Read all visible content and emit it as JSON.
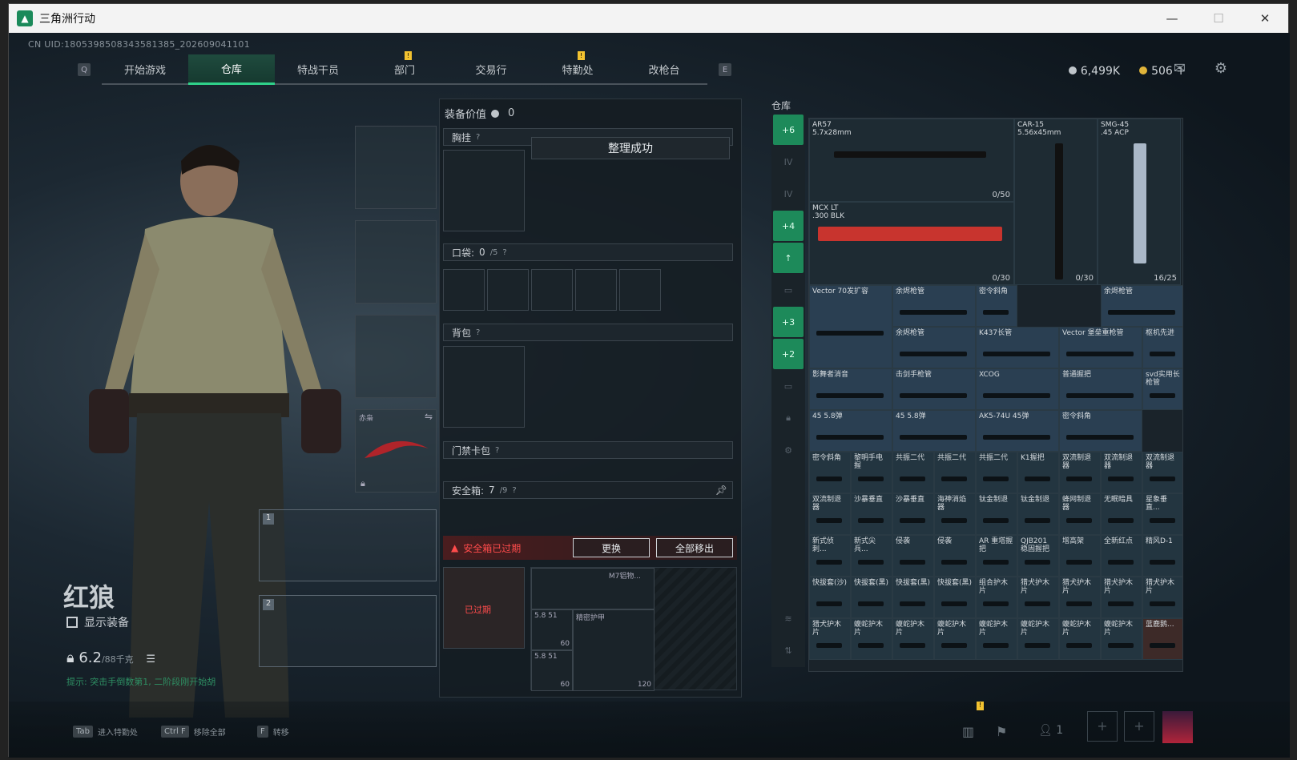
{
  "window": {
    "app_title": "三角洲行动",
    "controls": [
      "—",
      "☐",
      "✕"
    ]
  },
  "uid_text": "CN UID:1805398508343581385_202609041101",
  "tabs": {
    "left_key": "Q",
    "right_key": "E",
    "items": [
      {
        "label": "开始游戏",
        "active": false,
        "badge": ""
      },
      {
        "label": "仓库",
        "active": true,
        "badge": ""
      },
      {
        "label": "特战干员",
        "active": false,
        "badge": ""
      },
      {
        "label": "部门",
        "active": false,
        "badge": "!"
      },
      {
        "label": "交易行",
        "active": false,
        "badge": ""
      },
      {
        "label": "特勤处",
        "active": false,
        "badge": "!"
      },
      {
        "label": "改枪台",
        "active": false,
        "badge": ""
      }
    ]
  },
  "currency": {
    "silver": "6,499K",
    "gold": "506",
    "gold_add": "+"
  },
  "character": {
    "name": "红狼",
    "show_equipment_label": "显示装备",
    "weight_value": "6.2",
    "weight_max": "/88千克",
    "hint": "提示: 突击手倒数第1, 二阶段刚开始胡",
    "melee_label": "赤枭",
    "slot_numbers": [
      "1",
      "2"
    ]
  },
  "equipment": {
    "value_label": "装备价值",
    "value_amount": "0",
    "chest_label": "胸挂",
    "toast": "整理成功",
    "pocket_label": "口袋:",
    "pocket_count": "0",
    "pocket_max": "/5",
    "backpack_label": "背包",
    "keycard_label": "门禁卡包",
    "safe_label": "安全箱:",
    "safe_count": "7",
    "safe_max": "/9",
    "expired_text": "安全箱已过期",
    "replace_btn": "更换",
    "remove_all_btn": "全部移出",
    "safe_expired_tag": "已过期",
    "safe_items": [
      {
        "label": "M7铝物...",
        "count": ""
      },
      {
        "label": "5.8 51",
        "count": "60"
      },
      {
        "label": "5.8 51",
        "count": "60"
      },
      {
        "label": "精密护甲",
        "count": "120"
      }
    ],
    "help_mark": "?"
  },
  "storage": {
    "title": "仓库",
    "side_items": [
      "+6",
      "IV",
      "IV",
      "+4",
      "↑",
      "",
      "+3",
      "+2",
      "",
      "",
      "",
      ""
    ],
    "weapons": [
      {
        "name": "AR57",
        "ammo": "5.7x28mm",
        "count": "0/50"
      },
      {
        "name": "CAR-15",
        "ammo": "5.56x45mm",
        "count": "0/30"
      },
      {
        "name": "SMG-45",
        "ammo": ".45 ACP",
        "count": "16/25"
      },
      {
        "name": "MCX LT",
        "ammo": ".300 BLK",
        "count": "0/30"
      }
    ],
    "parts": [
      "Vector 70发扩容",
      "余烬枪管",
      "密令斜角",
      "余烬枪管",
      "余烬枪管",
      "K437长管",
      "Vector 堡垒重枪管",
      "枢机先进",
      "影舞者消音",
      "击剑手枪管",
      "XCOG",
      "普通握把",
      "svd实用长枪管",
      "45 5.8弹",
      "45 5.8弹",
      "AK5-74U 45弹",
      "密令斜角",
      "密令斜角",
      "黎明手电握",
      "共振二代",
      "共振二代",
      "共振二代",
      "K1握把",
      "双流制退器",
      "双流制退器",
      "双流制退器",
      "双流制退器",
      "沙暴垂直",
      "沙暴垂直",
      "海神消焰器",
      "钛金制退",
      "钛金制退",
      "蜂网制退器",
      "无眠暗具",
      "星象垂直...",
      "新式侦刺...",
      "新式尖兵...",
      "侵袭",
      "侵袭",
      "AR 重塔握把",
      "QJB201 稳固握把",
      "增高架",
      "全新红点",
      "精风D-1",
      "快拔套(沙)",
      "快拔套(黑)",
      "快拔套(黑)",
      "快拔套(黑)",
      "组合护木片",
      "猎犬护木片",
      "猎犬护木片",
      "猎犬护木片",
      "猎犬护木片",
      "猎犬护木片",
      "蝮蛇护木片",
      "蝮蛇护木片",
      "蝮蛇护木片",
      "蝮蛇护木片",
      "蝮蛇护木片",
      "蝮蛇护木片",
      "蝮蛇护木片",
      "蓝鹿鹅..."
    ]
  },
  "bottom": {
    "keys": [
      {
        "key": "Tab",
        "label": "进入特勤处"
      },
      {
        "key": "Ctrl F",
        "label": "移除全部"
      },
      {
        "key": "F",
        "label": "转移"
      }
    ],
    "squad_count": "1",
    "badge": "!"
  },
  "colors": {
    "accent_green": "#2fd18a",
    "expired_red": "#ff4b4b",
    "badge_yellow": "#f2c230"
  }
}
